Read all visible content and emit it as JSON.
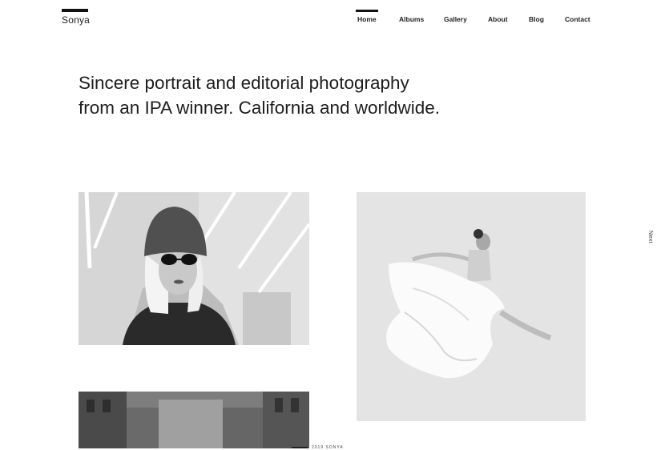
{
  "header": {
    "logo_text": "Sonya",
    "nav": [
      {
        "label": "Home",
        "active": true
      },
      {
        "label": "Albums",
        "active": false
      },
      {
        "label": "Gallery",
        "active": false
      },
      {
        "label": "About",
        "active": false
      },
      {
        "label": "Blog",
        "active": false
      },
      {
        "label": "Contact",
        "active": false
      }
    ]
  },
  "hero": {
    "headline": "Sincere portrait and editorial photography from an IPA winner. California and worldwide."
  },
  "side": {
    "next_label": "Next"
  },
  "footer": {
    "credit": "2019 SONYA"
  }
}
